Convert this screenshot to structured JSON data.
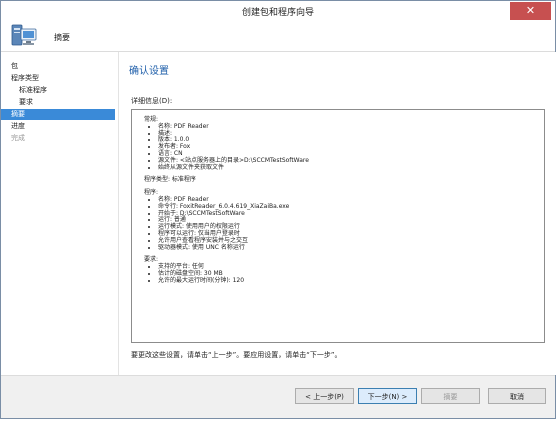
{
  "window": {
    "title": "创建包和程序向导",
    "close_label": "✕"
  },
  "header": {
    "title": "摘要"
  },
  "sidebar": {
    "items": [
      {
        "label": "包",
        "state": "normal"
      },
      {
        "label": "程序类型",
        "state": "normal"
      },
      {
        "label": "标准程序",
        "state": "normal"
      },
      {
        "label": "要求",
        "state": "normal"
      },
      {
        "label": "摘要",
        "state": "active"
      },
      {
        "label": "进度",
        "state": "normal"
      },
      {
        "label": "完成",
        "state": "disabled"
      }
    ]
  },
  "main": {
    "page_title": "确认设置",
    "details_label": "详细信息(D):",
    "hint": "要更改这些设置，请单击“上一步”。要应用设置，请单击“下一步”。",
    "sections": {
      "general_title": "常规:",
      "general_items": [
        "名称: PDF Reader",
        "描述:",
        "版本: 1.0.0",
        "发布者: Fox",
        "语言: CN",
        "源文件: <站点服务器上的目录>D:\\SCCMTestSoftWare",
        "始终从源文件夹获取文件"
      ],
      "program_type": "程序类型: 标准程序",
      "program_title": "程序:",
      "program_items": [
        "名称: PDF Reader",
        "命令行: FoxitReader_6.0.4.619_XiaZaiBa.exe",
        "开始于: D:\\SCCMTestSoftWare",
        "运行: 普通",
        "运行模式: 使用用户的权限运行",
        "程序可以运行: 仅当用户登录时",
        "允许用户查看程序安装并与之交互",
        "驱动器模式: 使用 UNC 名称运行"
      ],
      "requirements_title": "要求:",
      "requirements_items": [
        "支持的平台: 任何",
        "估计的磁盘空间: 30 MB",
        "允许的最大运行时间(分钟): 120"
      ]
    }
  },
  "footer": {
    "back": "< 上一步(P)",
    "next": "下一步(N) >",
    "summary": "摘要",
    "cancel": "取消"
  }
}
